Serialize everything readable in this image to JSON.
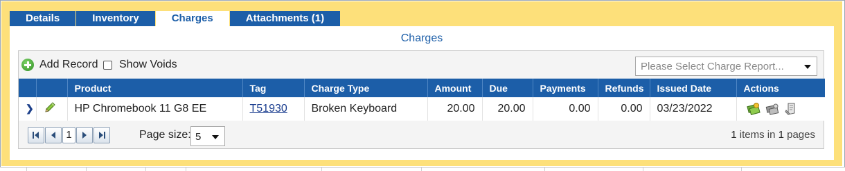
{
  "tabs": [
    {
      "label": "Details",
      "active": false
    },
    {
      "label": "Inventory",
      "active": false
    },
    {
      "label": "Charges",
      "active": true
    },
    {
      "label": "Attachments (1)",
      "active": false
    }
  ],
  "section_title": "Charges",
  "toolbar": {
    "add_record_label": "Add Record",
    "show_voids_label": "Show Voids",
    "show_voids_checked": false,
    "report_placeholder": "Please Select Charge Report..."
  },
  "grid": {
    "columns": [
      "",
      "",
      "Product",
      "Tag",
      "Charge Type",
      "Amount",
      "Due",
      "Payments",
      "Refunds",
      "Issued Date",
      "Actions"
    ],
    "rows": [
      {
        "product": "HP Chromebook 11 G8 EE",
        "tag": "T51930",
        "charge_type": "Broken Keyboard",
        "amount": "20.00",
        "due": "20.00",
        "payments": "0.00",
        "refunds": "0.00",
        "issued_date": "03/23/2022",
        "actions": [
          "pay-icon",
          "payment-plan-icon",
          "void-icon"
        ]
      }
    ]
  },
  "pager": {
    "current_page": "1",
    "page_size_label": "Page size:",
    "page_size": "5",
    "item_count": "1",
    "items_text": "items in",
    "page_count": "1",
    "pages_text": "pages"
  },
  "colors": {
    "panel": "#fde07a",
    "header_blue": "#1c5ea8",
    "link": "#1a3d8f"
  }
}
